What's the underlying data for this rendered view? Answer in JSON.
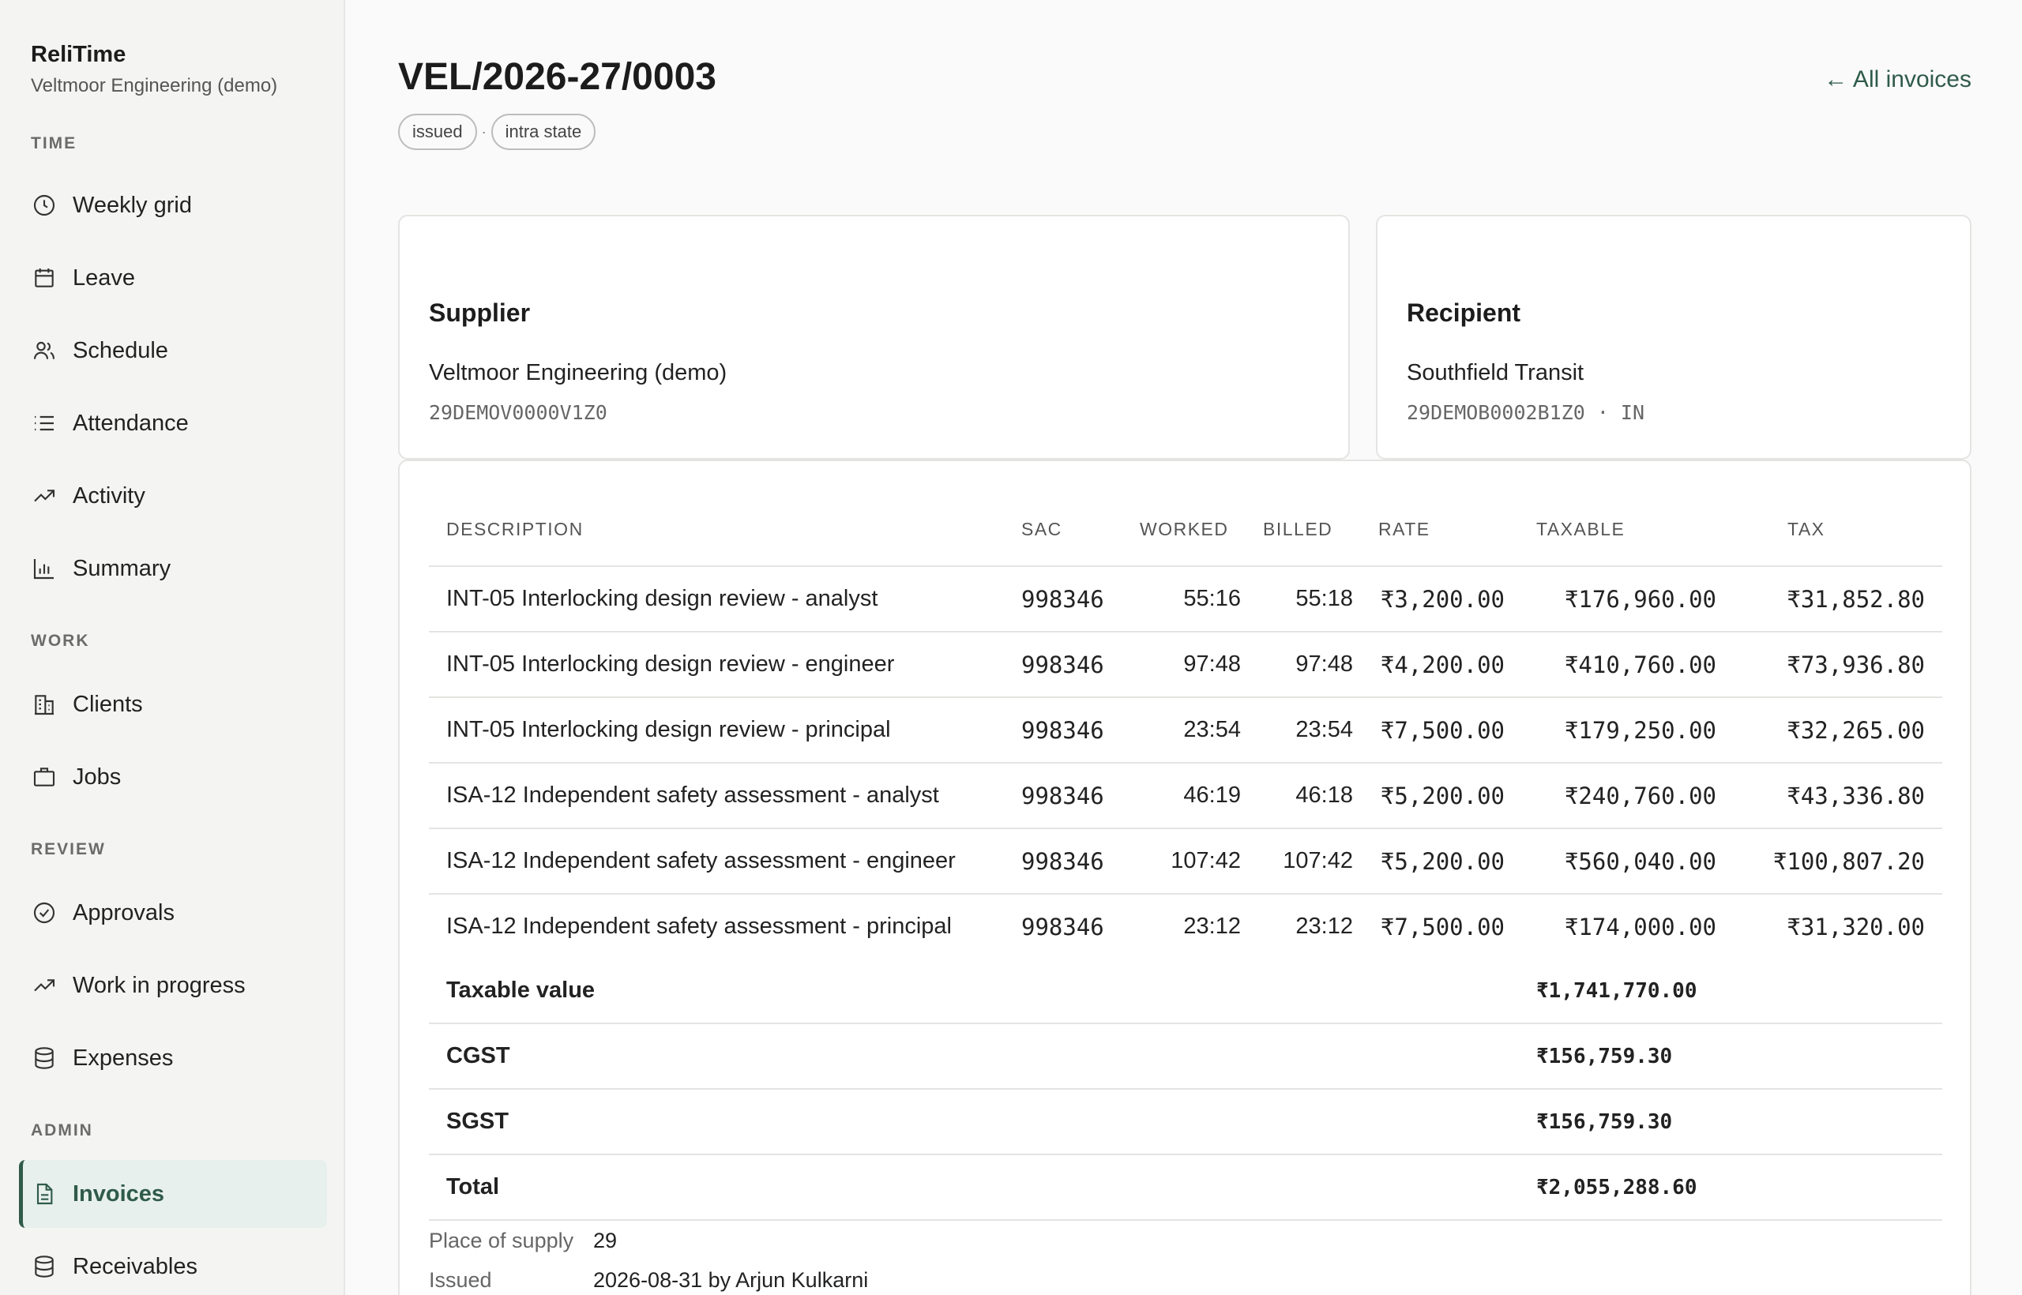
{
  "brand": {
    "name": "ReliTime",
    "org": "Veltmoor Engineering (demo)"
  },
  "sidebar": {
    "sections": [
      {
        "label": "TIME"
      },
      {
        "label": "WORK"
      },
      {
        "label": "REVIEW"
      },
      {
        "label": "ADMIN"
      }
    ],
    "items": [
      {
        "label": "Weekly grid",
        "icon": "clock-icon"
      },
      {
        "label": "Leave",
        "icon": "calendar-icon"
      },
      {
        "label": "Schedule",
        "icon": "users-icon"
      },
      {
        "label": "Attendance",
        "icon": "list-icon"
      },
      {
        "label": "Activity",
        "icon": "trending-up-icon"
      },
      {
        "label": "Summary",
        "icon": "bar-chart-icon"
      },
      {
        "label": "Clients",
        "icon": "building-icon"
      },
      {
        "label": "Jobs",
        "icon": "briefcase-icon"
      },
      {
        "label": "Approvals",
        "icon": "check-circle-icon"
      },
      {
        "label": "Work in progress",
        "icon": "trending-up-icon"
      },
      {
        "label": "Expenses",
        "icon": "database-icon"
      },
      {
        "label": "Invoices",
        "icon": "file-icon",
        "active": true
      },
      {
        "label": "Receivables",
        "icon": "database-icon"
      }
    ]
  },
  "header": {
    "title": "VEL/2026-27/0003",
    "back_link": "← All invoices",
    "tags": [
      "issued",
      "intra state"
    ],
    "tag_separator": "·"
  },
  "supplier": {
    "heading": "Supplier",
    "name": "Veltmoor Engineering (demo)",
    "gstin": "29DEMOV0000V1Z0"
  },
  "recipient": {
    "heading": "Recipient",
    "name": "Southfield Transit",
    "gstin": "29DEMOB0002B1Z0 · IN"
  },
  "table": {
    "columns": [
      "DESCRIPTION",
      "SAC",
      "WORKED",
      "BILLED",
      "RATE",
      "TAXABLE",
      "TAX"
    ],
    "rows": [
      [
        "INT-05 Interlocking design review - analyst",
        "998346",
        "55:16",
        "55:18",
        "₹3,200.00",
        "₹176,960.00",
        "₹31,852.80"
      ],
      [
        "INT-05 Interlocking design review - engineer",
        "998346",
        "97:48",
        "97:48",
        "₹4,200.00",
        "₹410,760.00",
        "₹73,936.80"
      ],
      [
        "INT-05 Interlocking design review - principal",
        "998346",
        "23:54",
        "23:54",
        "₹7,500.00",
        "₹179,250.00",
        "₹32,265.00"
      ],
      [
        "ISA-12 Independent safety assessment - analyst",
        "998346",
        "46:19",
        "46:18",
        "₹5,200.00",
        "₹240,760.00",
        "₹43,336.80"
      ],
      [
        "ISA-12 Independent safety assessment - engineer",
        "998346",
        "107:42",
        "107:42",
        "₹5,200.00",
        "₹560,040.00",
        "₹100,807.20"
      ],
      [
        "ISA-12 Independent safety assessment - principal",
        "998346",
        "23:12",
        "23:12",
        "₹7,500.00",
        "₹174,000.00",
        "₹31,320.00"
      ]
    ],
    "summary": [
      {
        "label": "Taxable value",
        "value": "₹1,741,770.00"
      },
      {
        "label": "CGST",
        "value": "₹156,759.30"
      },
      {
        "label": "SGST",
        "value": "₹156,759.30"
      },
      {
        "label": "Total",
        "value": "₹2,055,288.60"
      }
    ]
  },
  "meta": [
    {
      "key": "Place of supply",
      "value": "29"
    },
    {
      "key": "Issued",
      "value": "2026-08-31 by Arjun Kulkarni"
    }
  ]
}
